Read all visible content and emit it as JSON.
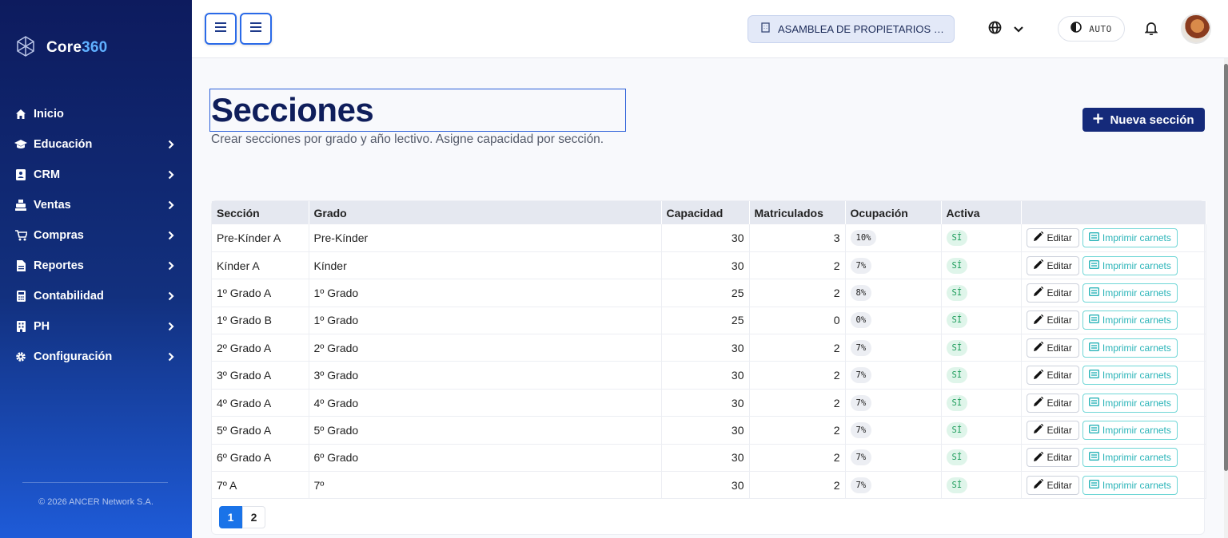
{
  "brand": {
    "name_part1": "Core",
    "name_part2": "360",
    "accent_color": "#5fb0ff"
  },
  "sidebar": {
    "items": [
      {
        "label": "Inicio",
        "icon": "home-icon",
        "has_children": false
      },
      {
        "label": "Educación",
        "icon": "graduation-cap-icon",
        "has_children": true
      },
      {
        "label": "CRM",
        "icon": "contact-book-icon",
        "has_children": true
      },
      {
        "label": "Ventas",
        "icon": "cash-register-icon",
        "has_children": true
      },
      {
        "label": "Compras",
        "icon": "shopping-cart-icon",
        "has_children": true
      },
      {
        "label": "Reportes",
        "icon": "report-file-icon",
        "has_children": true
      },
      {
        "label": "Contabilidad",
        "icon": "calculator-icon",
        "has_children": true
      },
      {
        "label": "PH",
        "icon": "building-icon",
        "has_children": true
      },
      {
        "label": "Configuración",
        "icon": "gear-icon",
        "has_children": true
      }
    ],
    "copyright": "© 2026 ANCER Network S.A."
  },
  "header": {
    "org_selector": "ASAMBLEA DE PROPIETARIOS DE ...",
    "theme_mode": "AUTO"
  },
  "page": {
    "title": "Secciones",
    "subtitle": "Crear secciones por grado y año lectivo. Asigne capacidad por sección.",
    "new_button": "Nueva sección"
  },
  "table": {
    "columns": [
      "Sección",
      "Grado",
      "Capacidad",
      "Matriculados",
      "Ocupación",
      "Activa",
      ""
    ],
    "edit_label": "Editar",
    "print_label": "Imprimir carnets",
    "rows": [
      {
        "seccion": "Pre-Kínder A",
        "grado": "Pre-Kínder",
        "capacidad": "30",
        "matriculados": "3",
        "ocupacion": "10%",
        "activa": "SÍ"
      },
      {
        "seccion": "Kínder A",
        "grado": "Kínder",
        "capacidad": "30",
        "matriculados": "2",
        "ocupacion": "7%",
        "activa": "SÍ"
      },
      {
        "seccion": "1º Grado A",
        "grado": "1º Grado",
        "capacidad": "25",
        "matriculados": "2",
        "ocupacion": "8%",
        "activa": "SÍ"
      },
      {
        "seccion": "1º Grado B",
        "grado": "1º Grado",
        "capacidad": "25",
        "matriculados": "0",
        "ocupacion": "0%",
        "activa": "SÍ"
      },
      {
        "seccion": "2º Grado A",
        "grado": "2º Grado",
        "capacidad": "30",
        "matriculados": "2",
        "ocupacion": "7%",
        "activa": "SÍ"
      },
      {
        "seccion": "3º Grado A",
        "grado": "3º Grado",
        "capacidad": "30",
        "matriculados": "2",
        "ocupacion": "7%",
        "activa": "SÍ"
      },
      {
        "seccion": "4º Grado A",
        "grado": "4º Grado",
        "capacidad": "30",
        "matriculados": "2",
        "ocupacion": "7%",
        "activa": "SÍ"
      },
      {
        "seccion": "5º Grado A",
        "grado": "5º Grado",
        "capacidad": "30",
        "matriculados": "2",
        "ocupacion": "7%",
        "activa": "SÍ"
      },
      {
        "seccion": "6º Grado A",
        "grado": "6º Grado",
        "capacidad": "30",
        "matriculados": "2",
        "ocupacion": "7%",
        "activa": "SÍ"
      },
      {
        "seccion": "7º A",
        "grado": "7º",
        "capacidad": "30",
        "matriculados": "2",
        "ocupacion": "7%",
        "activa": "SÍ"
      }
    ]
  },
  "pagination": {
    "pages": [
      "1",
      "2"
    ],
    "current": "1"
  }
}
